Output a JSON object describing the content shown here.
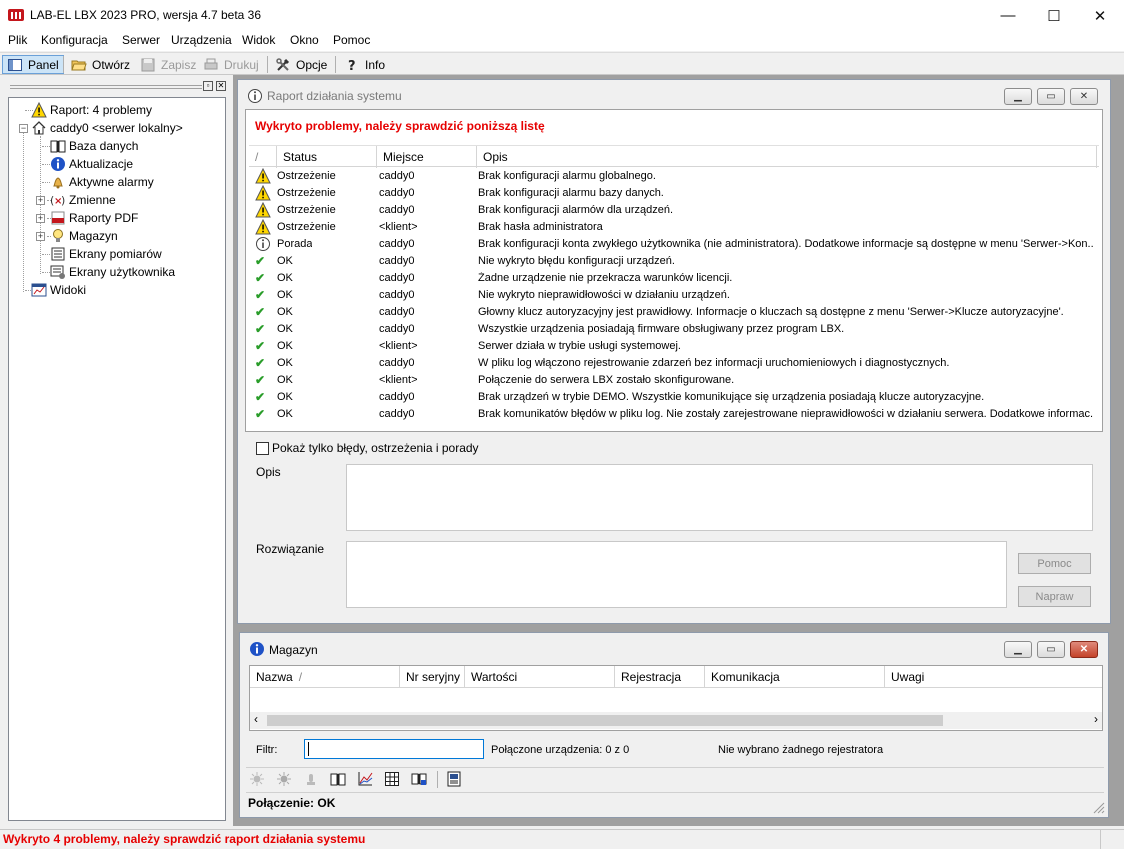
{
  "window": {
    "title": "LAB-EL LBX 2023 PRO, wersja 4.7 beta 36",
    "controls": {
      "minimize": "—",
      "maximize": "☐",
      "close": "✕"
    }
  },
  "menu": [
    "Plik",
    "Konfiguracja",
    "Serwer",
    "Urządzenia",
    "Widok",
    "Okno",
    "Pomoc"
  ],
  "toolbar": {
    "panel": "Panel",
    "open": "Otwórz",
    "save": "Zapisz",
    "print": "Drukuj",
    "options": "Opcje",
    "info": "Info"
  },
  "tree": [
    {
      "label": "Raport: 4 problemy",
      "icon": "warning-icon"
    },
    {
      "label": "caddy0 <serwer lokalny>",
      "icon": "home-icon"
    },
    {
      "label": "Baza danych",
      "icon": "book-icon"
    },
    {
      "label": "Aktualizacje",
      "icon": "info-icon"
    },
    {
      "label": "Aktywne alarmy",
      "icon": "bell-icon"
    },
    {
      "label": "Zmienne",
      "icon": "variable-icon"
    },
    {
      "label": "Raporty PDF",
      "icon": "pdf-icon"
    },
    {
      "label": "Magazyn",
      "icon": "bulb-icon"
    },
    {
      "label": "Ekrany pomiarów",
      "icon": "screen-icon"
    },
    {
      "label": "Ekrany użytkownika",
      "icon": "user-screen-icon"
    },
    {
      "label": "Widoki",
      "icon": "views-icon"
    }
  ],
  "report": {
    "title": "Raport działania systemu",
    "banner": "Wykryto problemy, należy sprawdzić poniższą listę",
    "columns": {
      "sort": "/",
      "status": "Status",
      "place": "Miejsce",
      "desc": "Opis"
    },
    "rows": [
      {
        "kind": "warn",
        "status": "Ostrzeżenie",
        "place": "caddy0",
        "desc": "Brak konfiguracji alarmu globalnego."
      },
      {
        "kind": "warn",
        "status": "Ostrzeżenie",
        "place": "caddy0",
        "desc": "Brak konfiguracji alarmu bazy danych."
      },
      {
        "kind": "warn",
        "status": "Ostrzeżenie",
        "place": "caddy0",
        "desc": "Brak konfiguracji alarmów dla urządzeń."
      },
      {
        "kind": "warn",
        "status": "Ostrzeżenie",
        "place": "<klient>",
        "desc": "Brak hasła administratora"
      },
      {
        "kind": "tip",
        "status": "Porada",
        "place": "caddy0",
        "desc": "Brak konfiguracji konta zwykłego użytkownika (nie administratora). Dodatkowe informacje są dostępne w menu 'Serwer->Kon..."
      },
      {
        "kind": "ok",
        "status": "OK",
        "place": "caddy0",
        "desc": "Nie wykryto błędu konfiguracji urządzeń."
      },
      {
        "kind": "ok",
        "status": "OK",
        "place": "caddy0",
        "desc": "Żadne urządzenie nie przekracza warunków licencji."
      },
      {
        "kind": "ok",
        "status": "OK",
        "place": "caddy0",
        "desc": "Nie wykryto nieprawidłowości w działaniu urządzeń."
      },
      {
        "kind": "ok",
        "status": "OK",
        "place": "caddy0",
        "desc": "Głowny klucz autoryzacyjny jest prawidłowy. Informacje o kluczach są dostępne z menu 'Serwer->Klucze autoryzacyjne'."
      },
      {
        "kind": "ok",
        "status": "OK",
        "place": "caddy0",
        "desc": "Wszystkie urządzenia posiadają firmware obsługiwany przez program LBX."
      },
      {
        "kind": "ok",
        "status": "OK",
        "place": "<klient>",
        "desc": "Serwer działa w trybie usługi systemowej."
      },
      {
        "kind": "ok",
        "status": "OK",
        "place": "caddy0",
        "desc": "W pliku log włączono rejestrowanie zdarzeń bez informacji uruchomieniowych i diagnostycznych."
      },
      {
        "kind": "ok",
        "status": "OK",
        "place": "<klient>",
        "desc": "Połączenie do serwera LBX zostało skonfigurowane."
      },
      {
        "kind": "ok",
        "status": "OK",
        "place": "caddy0",
        "desc": "Brak urządzeń w trybie DEMO. Wszystkie komunikujące się urządzenia posiadają klucze autoryzacyjne."
      },
      {
        "kind": "ok",
        "status": "OK",
        "place": "caddy0",
        "desc": "Brak komunikatów błędów w pliku log. Nie zostały zarejestrowane nieprawidłowości w działaniu serwera. Dodatkowe informac..."
      }
    ],
    "filter_checkbox": "Pokaż tylko błędy, ostrzeżenia i porady",
    "opis_label": "Opis",
    "solution_label": "Rozwiązanie",
    "help_button": "Pomoc",
    "fix_button": "Napraw"
  },
  "magazyn": {
    "title": "Magazyn",
    "columns": [
      "Nazwa",
      "Nr seryjny",
      "Wartości",
      "Rejestracja",
      "Komunikacja",
      "Uwagi"
    ],
    "filter_label": "Filtr:",
    "filter_value": "",
    "connected": "Połączone urządzenia: 0 z 0",
    "no_logger": "Nie wybrano żadnego rejestratora",
    "connection": "Połączenie: OK"
  },
  "statusbar": "Wykryto 4 problemy, należy sprawdzić raport działania systemu",
  "colors": {
    "error_red": "#e60000",
    "ok_green": "#2a9d2a",
    "warn_yellow": "#ffd700",
    "info_blue": "#1f52c6"
  }
}
